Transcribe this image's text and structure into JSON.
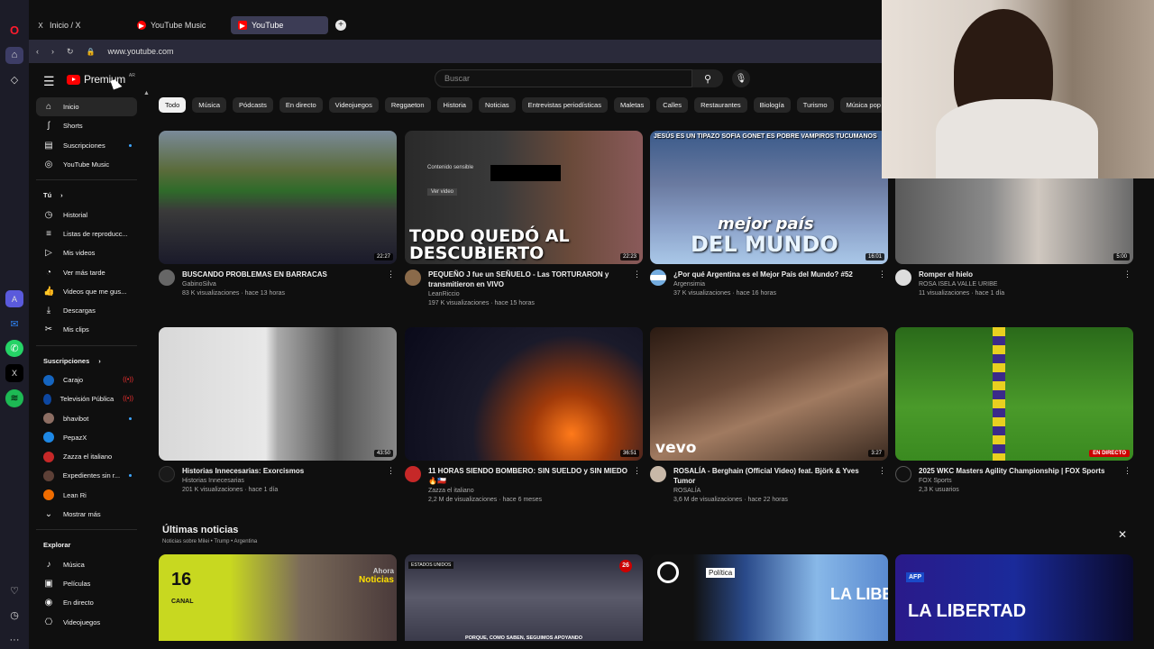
{
  "browser": {
    "tabs": [
      {
        "label": "Inicio / X",
        "icon": "X"
      },
      {
        "label": "YouTube Music",
        "icon": "▶"
      },
      {
        "label": "YouTube",
        "icon": "▶"
      }
    ],
    "url": "www.youtube.com"
  },
  "header": {
    "logo_text": "Premium",
    "logo_region": "AR",
    "search_placeholder": "Buscar"
  },
  "sidebar": {
    "main": [
      {
        "label": "Inicio",
        "icon": "home-icon"
      },
      {
        "label": "Shorts",
        "icon": "shorts-icon"
      },
      {
        "label": "Suscripciones",
        "icon": "subscriptions-icon"
      },
      {
        "label": "YouTube Music",
        "icon": "music-icon"
      }
    ],
    "you_header": "Tú",
    "you": [
      {
        "label": "Historial"
      },
      {
        "label": "Listas de reproducc..."
      },
      {
        "label": "Mis videos"
      },
      {
        "label": "Ver más tarde"
      },
      {
        "label": "Videos que me gus..."
      },
      {
        "label": "Descargas"
      },
      {
        "label": "Mis clips"
      }
    ],
    "subs_header": "Suscripciones",
    "subs": [
      {
        "label": "Carajo",
        "color": "#1565c0"
      },
      {
        "label": "Televisión Pública",
        "color": "#0d47a1"
      },
      {
        "label": "bhavibot",
        "color": "#8d6e63"
      },
      {
        "label": "PepazX",
        "color": "#1e88e5"
      },
      {
        "label": "Zazza el italiano",
        "color": "#c62828"
      },
      {
        "label": "Expedientes sin r...",
        "color": "#5d4037"
      },
      {
        "label": "Lean Ri",
        "color": "#ef6c00"
      },
      {
        "label": "Mostrar más"
      }
    ],
    "explore_header": "Explorar",
    "explore": [
      {
        "label": "Música"
      },
      {
        "label": "Películas"
      },
      {
        "label": "En directo"
      },
      {
        "label": "Videojuegos"
      }
    ]
  },
  "chips": [
    "Todo",
    "Música",
    "Pódcasts",
    "En directo",
    "Videojuegos",
    "Reggaeton",
    "Historia",
    "Noticias",
    "Entrevistas periodísticas",
    "Maletas",
    "Calles",
    "Restaurantes",
    "Biología",
    "Turismo",
    "Música pop"
  ],
  "videos": [
    {
      "title": "BUSCANDO PROBLEMAS EN BARRACAS",
      "channel": "GabinoSilva",
      "stats": "83 K visualizaciones · hace 13 horas",
      "duration": "22:27"
    },
    {
      "title": "PEQUEÑO J fue un SEÑUELO - Las TORTURARON y transmitieron en VIVO",
      "channel": "LeanRiccio",
      "stats": "197 K visualizaciones · hace 15 horas",
      "duration": "22:23",
      "overlay": "TODO QUEDÓ AL DESCUBIERTO",
      "sensitive": "Contenido sensible",
      "sensitive_btn": "Ver video"
    },
    {
      "title": "¿Por qué Argentina es el Mejor País del Mundo? #52",
      "channel": "Argensimia",
      "stats": "37 K visualizaciones · hace 16 horas",
      "duration": "16:01",
      "overlay_top": "JESÚS ES UN TIPAZO   SOFIA GONET ES POBRE   VAMPIROS TUCUMANOS",
      "overlay_a": "mejor país",
      "overlay_b": "DEL MUNDO"
    },
    {
      "title": "Romper el hielo",
      "channel": "ROSA ISELA VALLE URIBE",
      "stats": "11 visualizaciones · hace 1 día",
      "duration": "5:00"
    },
    {
      "title": "Historias Innecesarias: Exorcismos",
      "channel": "Historias Innecesarias",
      "stats": "201 K visualizaciones · hace 1 día",
      "duration": "43:50"
    },
    {
      "title": "11 HORAS SIENDO BOMBERO: SIN SUELDO y SIN MIEDO 🔥🇨🇱",
      "channel": "Zazza el italiano",
      "stats": "2,2 M de visualizaciones · hace 6 meses",
      "duration": "36:51"
    },
    {
      "title": "ROSALÍA - Berghain (Official Video) feat. Björk & Yves Tumor",
      "channel": "ROSALÍA",
      "stats": "3,6 M de visualizaciones · hace 22 horas",
      "duration": "3:27",
      "overlay": "vevo"
    },
    {
      "title": "2025 WKC Masters Agility Championship | FOX Sports",
      "channel": "FOX Sports",
      "stats": "2,3 K usuarios",
      "duration": "EN DIRECTO"
    }
  ],
  "news": {
    "title": "Últimas noticias",
    "subtitle": "Noticias sobre Milei • Trump • Argentina",
    "cards": [
      {
        "text_a": "Ahora",
        "text_b": "Noticias",
        "badge": "CANAL"
      },
      {
        "text_a": "ESTADOS UNIDOS",
        "text_b": "PORQUE, COMO SABEN, SEGUIMOS APOYANDO",
        "badge": "26"
      },
      {
        "text_a": "Política",
        "text_b": "LA LIBER"
      },
      {
        "text_a": "AFP",
        "text_b": "LA LIBERTAD"
      }
    ]
  }
}
